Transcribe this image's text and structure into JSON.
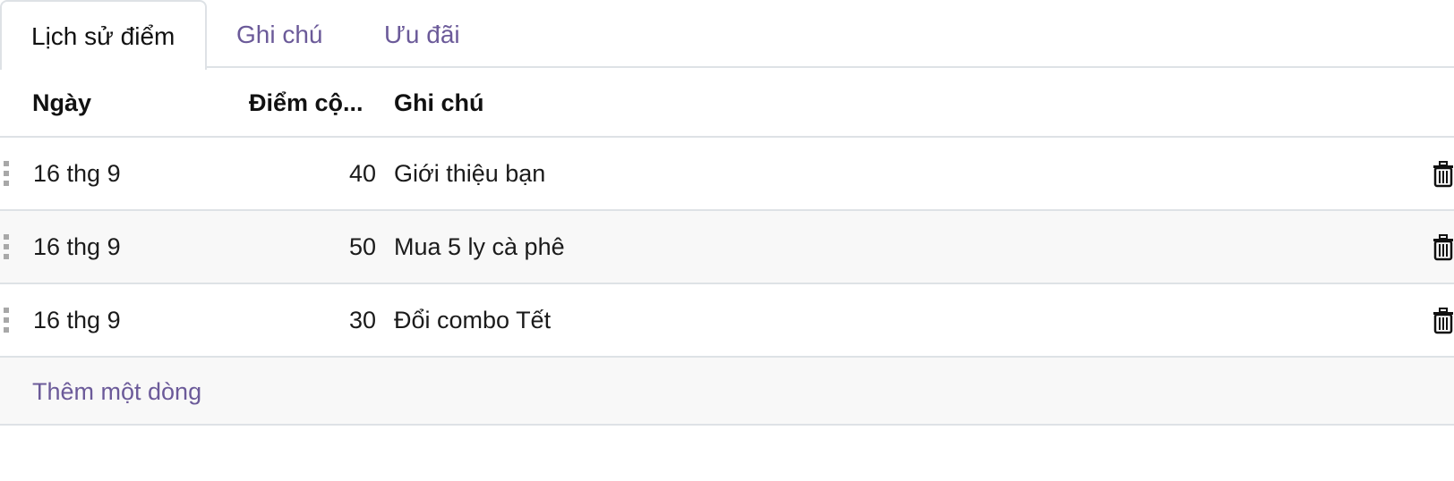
{
  "tabs": [
    {
      "label": "Lịch sử điểm",
      "active": true
    },
    {
      "label": "Ghi chú",
      "active": false
    },
    {
      "label": "Ưu đãi",
      "active": false
    }
  ],
  "table": {
    "headers": {
      "date": "Ngày",
      "points": "Điểm cộ...",
      "note": "Ghi chú"
    },
    "rows": [
      {
        "date": "16 thg 9",
        "points": "40",
        "note": "Giới thiệu bạn"
      },
      {
        "date": "16 thg 9",
        "points": "50",
        "note": "Mua 5 ly cà phê"
      },
      {
        "date": "16 thg 9",
        "points": "30",
        "note": "Đổi combo Tết"
      }
    ],
    "add_line_label": "Thêm một dòng"
  },
  "icons": {
    "row_handle": "drag-handle-icon",
    "row_delete": "trash-icon"
  },
  "colors": {
    "accent": "#6b5a99",
    "border": "#dee2e6",
    "row_stripe": "#f8f8f8"
  }
}
